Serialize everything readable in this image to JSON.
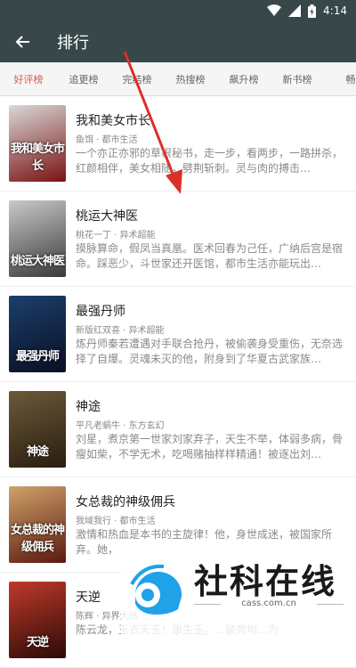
{
  "status_bar": {
    "time": "4:14",
    "icons": [
      "wifi-icon",
      "signal-icon",
      "battery-icon"
    ]
  },
  "app_bar": {
    "title": "排行",
    "back_icon": "arrow-left-icon"
  },
  "tabs": [
    {
      "label": "好评榜",
      "active": true
    },
    {
      "label": "追更榜",
      "active": false
    },
    {
      "label": "完结榜",
      "active": false
    },
    {
      "label": "热搜榜",
      "active": false
    },
    {
      "label": "飙升榜",
      "active": false
    },
    {
      "label": "新书榜",
      "active": false
    },
    {
      "label": "畅",
      "active": false
    }
  ],
  "books": [
    {
      "title": "我和美女市长",
      "meta": "鱼饵 · 都市生活",
      "desc": "一个亦正亦邪的草根秘书，走一步，看两步，一路拼杀，红颜相伴，美女相随，劈荆斩刺。灵与肉的搏击…",
      "cover_text": "我和美女市长",
      "cover_colors": [
        "#d8d8d8",
        "#7a1212"
      ]
    },
    {
      "title": "桃运大神医",
      "meta": "桃花一丁 · 异术超能",
      "desc": "摸脉算命，假凤当真凰。医术回春为己任，广纳后宫是宿命。踩恶少，斗世家还开医馆，都市生活亦能玩出…",
      "cover_text": "桃运大神医",
      "cover_colors": [
        "#c9c9c9",
        "#3a3a3a"
      ]
    },
    {
      "title": "最强丹师",
      "meta": "新版红双喜 · 异术超能",
      "desc": "炼丹师秦若遭遇对手联合抢丹，被偷袭身受重伤，无奈选择了自爆。灵魂未灭的他，附身到了华夏古武家族…",
      "cover_text": "最强丹师",
      "cover_colors": [
        "#1b3f6b",
        "#0a0f25"
      ]
    },
    {
      "title": "神途",
      "meta": "平凡老蜗牛 · 东方玄幻",
      "desc": "刘星，煮京第一世家刘家弃子，天生不举，体弱多病，骨瘦如柴，不学无术，吃喝赌抽样样精通！被逐出刘…",
      "cover_text": "神途",
      "cover_colors": [
        "#6b5a3a",
        "#2a1d10"
      ]
    },
    {
      "title": "女总裁的神级佣兵",
      "meta": "我域我行 · 都市生活",
      "desc": "激情和热血是本书的主旋律！他，身世成迷，被国家所弃。她，",
      "cover_text": "女总裁的神级佣兵",
      "cover_colors": [
        "#d0a26a",
        "#5a1a10"
      ]
    },
    {
      "title": "天逆",
      "meta": "陈辉 · 异界大陆",
      "desc": "陈云龙，玉衣天玉！康生玉，…破旁地…为",
      "cover_text": "天逆",
      "cover_colors": [
        "#c0392b",
        "#2b0b06"
      ]
    }
  ],
  "watermark": {
    "name": "社科在线",
    "url": "cass.com.cn"
  },
  "colors": {
    "bar": "#37474a",
    "accent": "#e5574b",
    "arrow": "#d9302b"
  }
}
